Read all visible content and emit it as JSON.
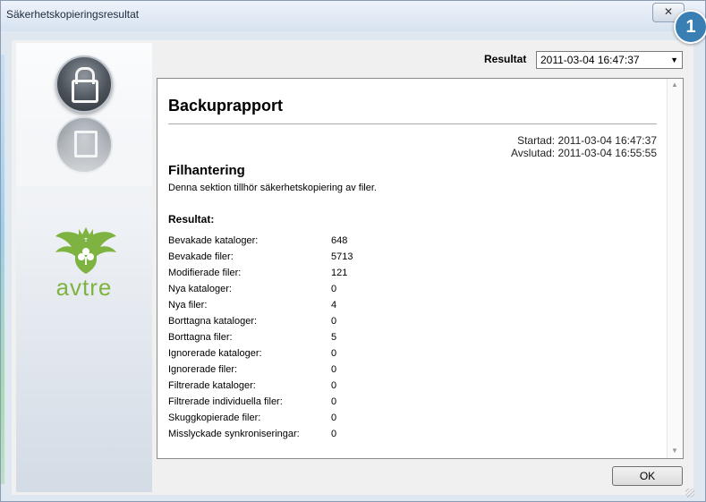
{
  "window": {
    "title": "Säkerhetskopieringsresultat",
    "close_glyph": "✕"
  },
  "badge": {
    "number": "1"
  },
  "header": {
    "result_label": "Resultat",
    "result_selected": "2011-03-04 16:47:37"
  },
  "sidebar": {
    "icons": [
      "lock-icon",
      "document-icon"
    ],
    "brand": "avtre",
    "brand_color": "#7fb341"
  },
  "report": {
    "title": "Backuprapport",
    "started": "Startad: 2011-03-04 16:47:37",
    "finished": "Avslutad: 2011-03-04 16:55:55",
    "section_title": "Filhantering",
    "section_desc": "Denna sektion tillhör säkerhetskopiering av filer.",
    "results_title": "Resultat:",
    "stats": [
      {
        "label": "Bevakade kataloger:",
        "value": "648"
      },
      {
        "label": "Bevakade filer:",
        "value": "5713"
      },
      {
        "label": "Modifierade filer:",
        "value": "121"
      },
      {
        "label": "Nya kataloger:",
        "value": "0"
      },
      {
        "label": "Nya filer:",
        "value": "4"
      },
      {
        "label": "Borttagna kataloger:",
        "value": "0"
      },
      {
        "label": "Borttagna filer:",
        "value": "5"
      },
      {
        "label": "Ignorerade kataloger:",
        "value": "0"
      },
      {
        "label": "Ignorerade filer:",
        "value": "0"
      },
      {
        "label": "Filtrerade kataloger:",
        "value": "0"
      },
      {
        "label": "Filtrerade individuella filer:",
        "value": "0"
      },
      {
        "label": "Skuggkopierade filer:",
        "value": "0"
      },
      {
        "label": "Misslyckade synkroniseringar:",
        "value": "0"
      }
    ]
  },
  "footer": {
    "ok_label": "OK"
  }
}
